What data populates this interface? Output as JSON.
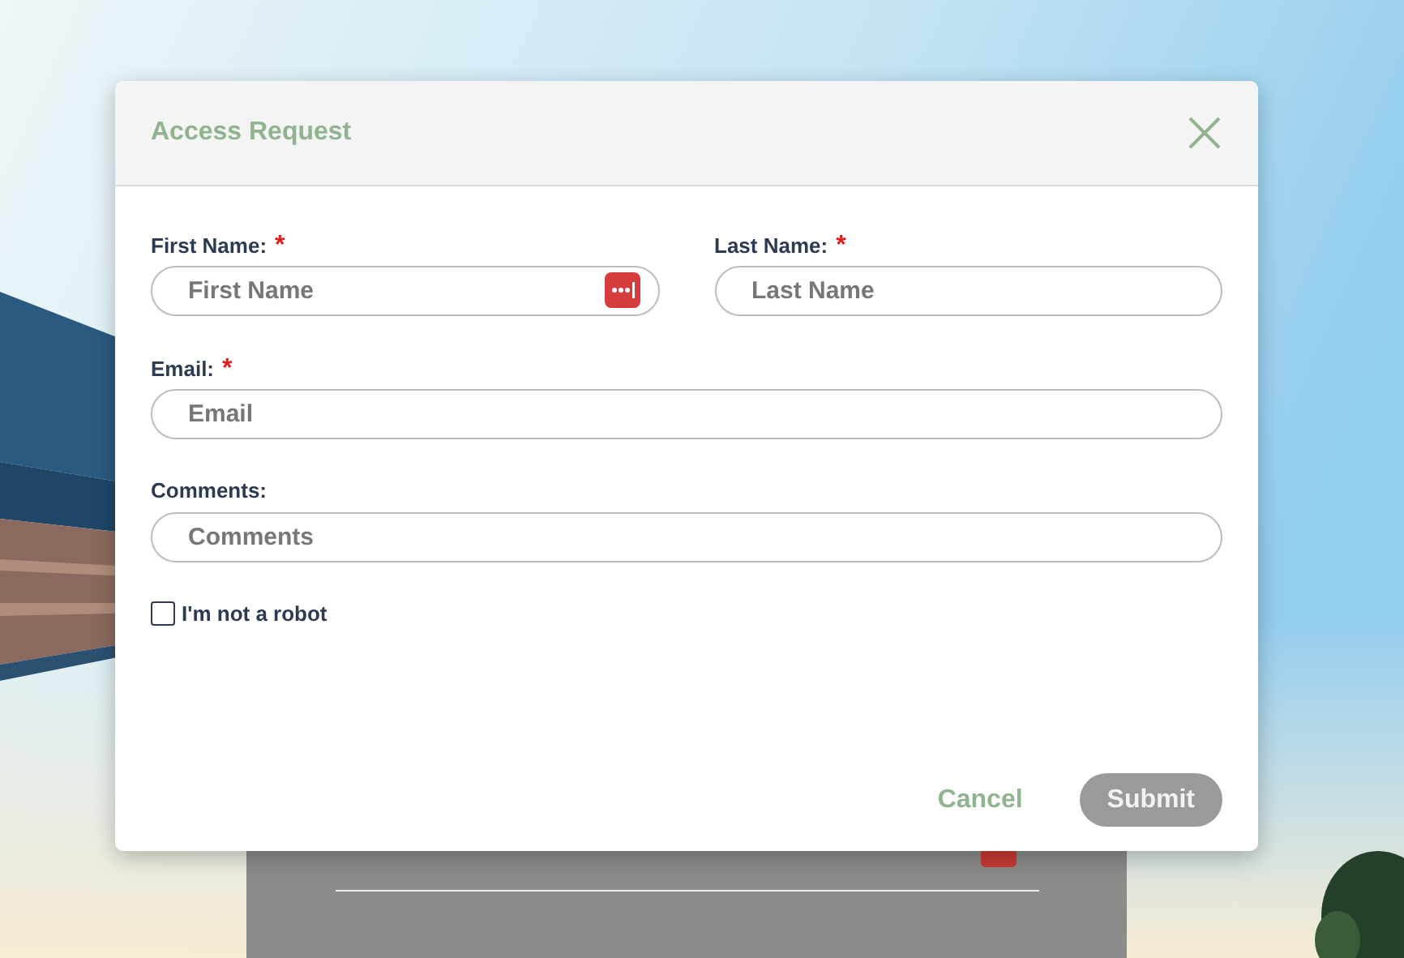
{
  "dialog": {
    "title": "Access Request",
    "rows": [
      [
        {
          "label": "First Name:",
          "required_mark": "*",
          "placeholder": "First Name",
          "password_manager_icon": true
        },
        {
          "label": "Last Name:",
          "required_mark": "*",
          "placeholder": "Last Name",
          "password_manager_icon": false
        }
      ],
      [
        {
          "label": "Email:",
          "required_mark": "*",
          "placeholder": "Email",
          "password_manager_icon": false
        }
      ],
      [
        {
          "label": "Comments:",
          "placeholder": "Comments",
          "password_manager_icon": false
        }
      ]
    ],
    "checkbox": {
      "label": "I'm not a robot",
      "checked": false
    },
    "buttons": [
      {
        "label": "Cancel",
        "kind": "text",
        "disabled": false
      },
      {
        "label": "Submit",
        "kind": "filled",
        "disabled": true
      }
    ]
  }
}
